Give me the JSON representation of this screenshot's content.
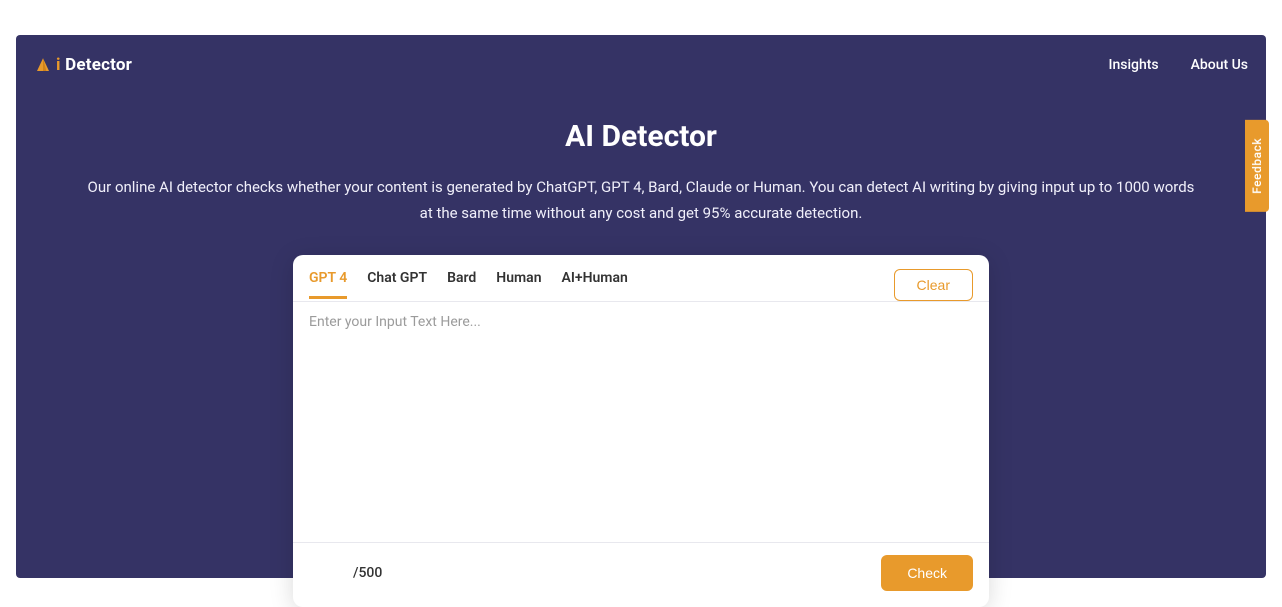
{
  "logo": {
    "ai_text": "i",
    "brand_text": "Detector"
  },
  "nav": {
    "insights": "Insights",
    "about": "About Us"
  },
  "hero": {
    "title": "AI Detector",
    "subtitle": "Our online AI detector checks whether your content is generated by ChatGPT, GPT 4, Bard, Claude or Human. You can detect AI writing by giving input up to 1000 words at the same time without any cost and get 95% accurate detection."
  },
  "card": {
    "tabs": {
      "gpt4": "GPT 4",
      "chatgpt": "Chat GPT",
      "bard": "Bard",
      "human": "Human",
      "aihuman": "AI+Human"
    },
    "clear_label": "Clear",
    "textarea_placeholder": "Enter your Input Text Here...",
    "counter": "/500",
    "check_label": "Check"
  },
  "feedback": {
    "label": "Feedback"
  }
}
